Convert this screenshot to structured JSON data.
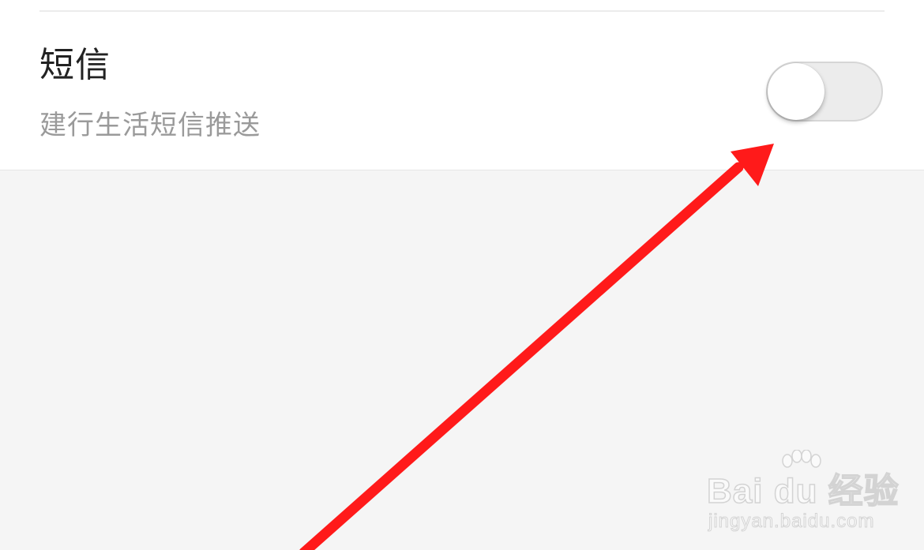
{
  "setting": {
    "title": "短信",
    "description": "建行生活短信推送",
    "toggle_on": false
  },
  "annotation": {
    "arrow_color": "#ff1a1a"
  },
  "watermark": {
    "brand": "Bai du 经验",
    "url": "jingyan.baidu.com"
  },
  "colors": {
    "background": "#f5f5f5",
    "card": "#ffffff",
    "title_text": "#222222",
    "desc_text": "#9a9a9a",
    "toggle_track_off": "#ececec"
  },
  "icons": {
    "watermark_logo": "baidu-paw-icon"
  }
}
